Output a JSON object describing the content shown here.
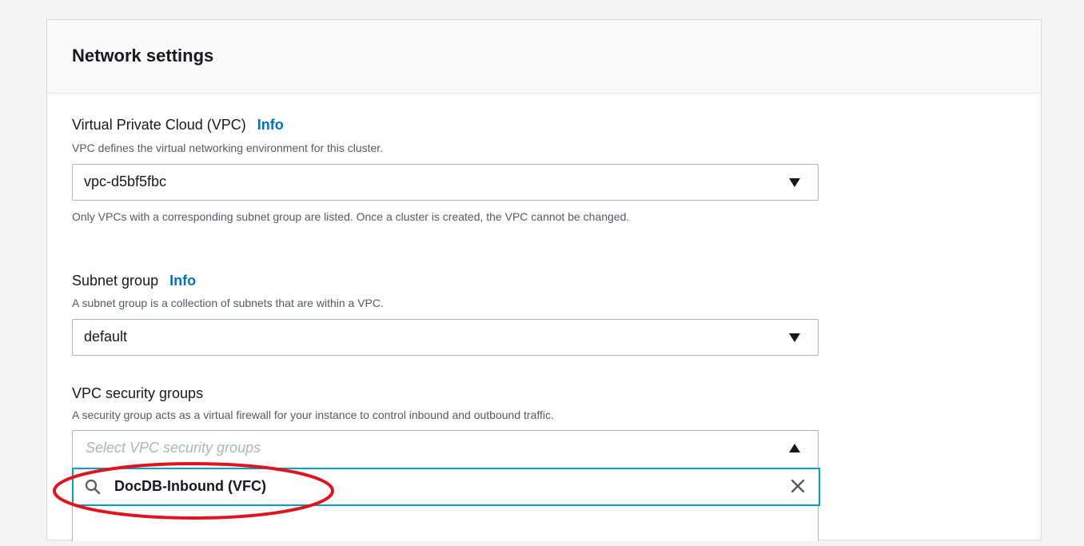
{
  "section": {
    "title": "Network settings"
  },
  "vpc": {
    "label": "Virtual Private Cloud (VPC)",
    "info": "Info",
    "description": "VPC defines the virtual networking environment for this cluster.",
    "value": "vpc-d5bf5fbc",
    "constraint": "Only VPCs with a corresponding subnet group are listed. Once a cluster is created, the VPC cannot be changed."
  },
  "subnet_group": {
    "label": "Subnet group",
    "info": "Info",
    "description": "A subnet group is a collection of subnets that are within a VPC.",
    "value": "default"
  },
  "security_groups": {
    "label": "VPC security groups",
    "description": "A security group acts as a virtual firewall for your instance to control inbound and outbound traffic.",
    "placeholder": "Select VPC security groups",
    "search_value": "DocDB-Inbound (VFC)"
  },
  "icons": {
    "vpc_caret": "caret-down-icon",
    "subnet_caret": "caret-down-icon",
    "security_caret": "caret-up-icon",
    "search": "search-icon",
    "clear": "close-icon"
  },
  "colors": {
    "link": "#0073bb",
    "focus_border": "#00a1c9",
    "annotation": "#e0141e"
  }
}
